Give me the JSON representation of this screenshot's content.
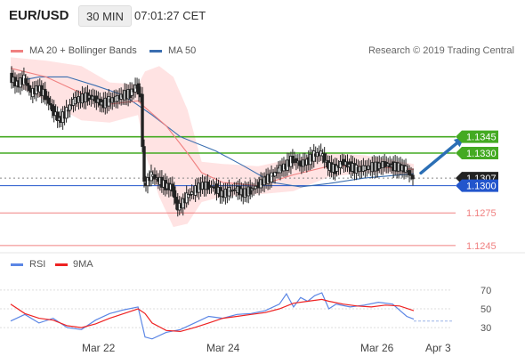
{
  "header": {
    "symbol": "EUR/USD",
    "timeframe": "30 MIN",
    "time": "07:01:27 CET"
  },
  "legend": {
    "ma20_label": "MA 20 + Bollinger Bands",
    "ma50_label": "MA 50",
    "research": "Research © 2019 Trading Central",
    "rsi_label": "RSI",
    "ma9_label": "9MA"
  },
  "colors": {
    "ma20": "#f08080",
    "bollinger_fill": "#ffd9d9",
    "ma50": "#3a6eb0",
    "resistance": "#44aa22",
    "support": "#f08080",
    "pivot": "#2255cc",
    "arrow": "#2b6fb5",
    "rsi": "#5b86e5",
    "rsi_ma": "#ee2222"
  },
  "chart_data": [
    {
      "type": "candlestick",
      "ylim": [
        1.124,
        1.142
      ],
      "x_ticks": [
        "Mar 22",
        "Mar 24",
        "Mar 26",
        "Apr 3"
      ],
      "levels": [
        {
          "value": 1.1345,
          "label": "1.1345",
          "kind": "resistance"
        },
        {
          "value": 1.133,
          "label": "1.1330",
          "kind": "resistance"
        },
        {
          "value": 1.1307,
          "label": "1.1307",
          "kind": "last"
        },
        {
          "value": 1.13,
          "label": "1.1300",
          "kind": "pivot"
        },
        {
          "value": 1.1275,
          "label": "1.1275",
          "kind": "support"
        },
        {
          "value": 1.1245,
          "label": "1.1245",
          "kind": "support"
        }
      ],
      "close_series": [
        [
          0,
          1.14
        ],
        [
          2,
          1.1393
        ],
        [
          4,
          1.1398
        ],
        [
          6,
          1.1385
        ],
        [
          8,
          1.139
        ],
        [
          10,
          1.1383
        ],
        [
          12,
          1.137
        ],
        [
          14,
          1.136
        ],
        [
          16,
          1.1368
        ],
        [
          18,
          1.1378
        ],
        [
          20,
          1.138
        ],
        [
          22,
          1.1382
        ],
        [
          24,
          1.138
        ],
        [
          26,
          1.1375
        ],
        [
          28,
          1.1378
        ],
        [
          30,
          1.138
        ],
        [
          32,
          1.1383
        ],
        [
          34,
          1.1385
        ],
        [
          36,
          1.1392
        ],
        [
          37,
          1.138
        ],
        [
          38,
          1.13
        ],
        [
          40,
          1.131
        ],
        [
          42,
          1.1305
        ],
        [
          44,
          1.13
        ],
        [
          46,
          1.1298
        ],
        [
          47,
          1.1283
        ],
        [
          48,
          1.128
        ],
        [
          50,
          1.129
        ],
        [
          52,
          1.1295
        ],
        [
          54,
          1.13
        ],
        [
          56,
          1.13
        ],
        [
          58,
          1.1298
        ],
        [
          60,
          1.1292
        ],
        [
          62,
          1.1295
        ],
        [
          64,
          1.1297
        ],
        [
          66,
          1.1293
        ],
        [
          68,
          1.1296
        ],
        [
          70,
          1.13
        ],
        [
          72,
          1.1305
        ],
        [
          74,
          1.1308
        ],
        [
          76,
          1.1315
        ],
        [
          78,
          1.1318
        ],
        [
          80,
          1.1325
        ],
        [
          82,
          1.132
        ],
        [
          84,
          1.1322
        ],
        [
          86,
          1.1328
        ],
        [
          88,
          1.133
        ],
        [
          90,
          1.1318
        ],
        [
          92,
          1.1315
        ],
        [
          94,
          1.1322
        ],
        [
          96,
          1.1318
        ],
        [
          98,
          1.1315
        ],
        [
          100,
          1.1316
        ],
        [
          102,
          1.1317
        ],
        [
          104,
          1.1318
        ],
        [
          106,
          1.132
        ],
        [
          108,
          1.1318
        ],
        [
          110,
          1.1317
        ],
        [
          112,
          1.1315
        ],
        [
          114,
          1.1307
        ]
      ],
      "ma20": [
        [
          0,
          1.1408
        ],
        [
          10,
          1.14
        ],
        [
          20,
          1.1385
        ],
        [
          28,
          1.1375
        ],
        [
          36,
          1.1378
        ],
        [
          38,
          1.1372
        ],
        [
          44,
          1.1355
        ],
        [
          50,
          1.133
        ],
        [
          54,
          1.1312
        ],
        [
          60,
          1.1303
        ],
        [
          70,
          1.13
        ],
        [
          80,
          1.131
        ],
        [
          90,
          1.1318
        ],
        [
          100,
          1.1318
        ],
        [
          114,
          1.1315
        ]
      ],
      "bb_upper": [
        [
          0,
          1.1418
        ],
        [
          10,
          1.1415
        ],
        [
          20,
          1.141
        ],
        [
          28,
          1.1395
        ],
        [
          36,
          1.1393
        ],
        [
          38,
          1.1405
        ],
        [
          42,
          1.141
        ],
        [
          46,
          1.14
        ],
        [
          50,
          1.137
        ],
        [
          54,
          1.1322
        ],
        [
          60,
          1.132
        ],
        [
          70,
          1.1318
        ],
        [
          80,
          1.1325
        ],
        [
          90,
          1.133
        ],
        [
          100,
          1.1328
        ],
        [
          114,
          1.132
        ]
      ],
      "bb_lower": [
        [
          0,
          1.1395
        ],
        [
          10,
          1.1378
        ],
        [
          20,
          1.136
        ],
        [
          28,
          1.1358
        ],
        [
          36,
          1.1365
        ],
        [
          38,
          1.133
        ],
        [
          42,
          1.129
        ],
        [
          46,
          1.1262
        ],
        [
          50,
          1.1265
        ],
        [
          54,
          1.1285
        ],
        [
          60,
          1.129
        ],
        [
          70,
          1.1292
        ],
        [
          80,
          1.1295
        ],
        [
          90,
          1.1308
        ],
        [
          100,
          1.1312
        ],
        [
          114,
          1.131
        ]
      ],
      "ma50": [
        [
          0,
          1.1395
        ],
        [
          8,
          1.14
        ],
        [
          16,
          1.14
        ],
        [
          24,
          1.1392
        ],
        [
          32,
          1.1383
        ],
        [
          40,
          1.1365
        ],
        [
          48,
          1.1345
        ],
        [
          58,
          1.1332
        ],
        [
          66,
          1.1318
        ],
        [
          74,
          1.1303
        ],
        [
          82,
          1.1299
        ],
        [
          90,
          1.1302
        ],
        [
          100,
          1.1307
        ],
        [
          114,
          1.1311
        ]
      ],
      "forecast_arrow": {
        "from": [
          114,
          1.131
        ],
        "to": [
          126,
          1.1344
        ]
      }
    },
    {
      "type": "line",
      "title": "RSI",
      "ylim": [
        15,
        85
      ],
      "y_ticks": [
        30,
        50,
        70
      ],
      "series": [
        {
          "name": "RSI",
          "values": [
            [
              0,
              37
            ],
            [
              4,
              44
            ],
            [
              8,
              35
            ],
            [
              12,
              40
            ],
            [
              16,
              30
            ],
            [
              20,
              28
            ],
            [
              24,
              38
            ],
            [
              28,
              45
            ],
            [
              32,
              49
            ],
            [
              36,
              52
            ],
            [
              38,
              20
            ],
            [
              40,
              18
            ],
            [
              44,
              25
            ],
            [
              48,
              28
            ],
            [
              52,
              35
            ],
            [
              56,
              42
            ],
            [
              60,
              40
            ],
            [
              64,
              44
            ],
            [
              68,
              45
            ],
            [
              72,
              48
            ],
            [
              76,
              55
            ],
            [
              78,
              66
            ],
            [
              80,
              52
            ],
            [
              82,
              62
            ],
            [
              84,
              58
            ],
            [
              86,
              64
            ],
            [
              88,
              67
            ],
            [
              90,
              50
            ],
            [
              92,
              55
            ],
            [
              96,
              52
            ],
            [
              100,
              54
            ],
            [
              104,
              57
            ],
            [
              108,
              55
            ],
            [
              112,
              42
            ],
            [
              114,
              39
            ]
          ]
        },
        {
          "name": "9MA",
          "values": [
            [
              0,
              55
            ],
            [
              4,
              45
            ],
            [
              8,
              40
            ],
            [
              12,
              38
            ],
            [
              16,
              32
            ],
            [
              20,
              30
            ],
            [
              24,
              34
            ],
            [
              28,
              40
            ],
            [
              32,
              45
            ],
            [
              36,
              50
            ],
            [
              38,
              45
            ],
            [
              40,
              35
            ],
            [
              44,
              27
            ],
            [
              48,
              26
            ],
            [
              52,
              30
            ],
            [
              56,
              35
            ],
            [
              60,
              40
            ],
            [
              64,
              42
            ],
            [
              68,
              44
            ],
            [
              72,
              46
            ],
            [
              76,
              50
            ],
            [
              80,
              56
            ],
            [
              84,
              58
            ],
            [
              88,
              60
            ],
            [
              90,
              58
            ],
            [
              94,
              55
            ],
            [
              98,
              53
            ],
            [
              102,
              52
            ],
            [
              106,
              54
            ],
            [
              110,
              53
            ],
            [
              114,
              48
            ]
          ]
        }
      ]
    }
  ]
}
